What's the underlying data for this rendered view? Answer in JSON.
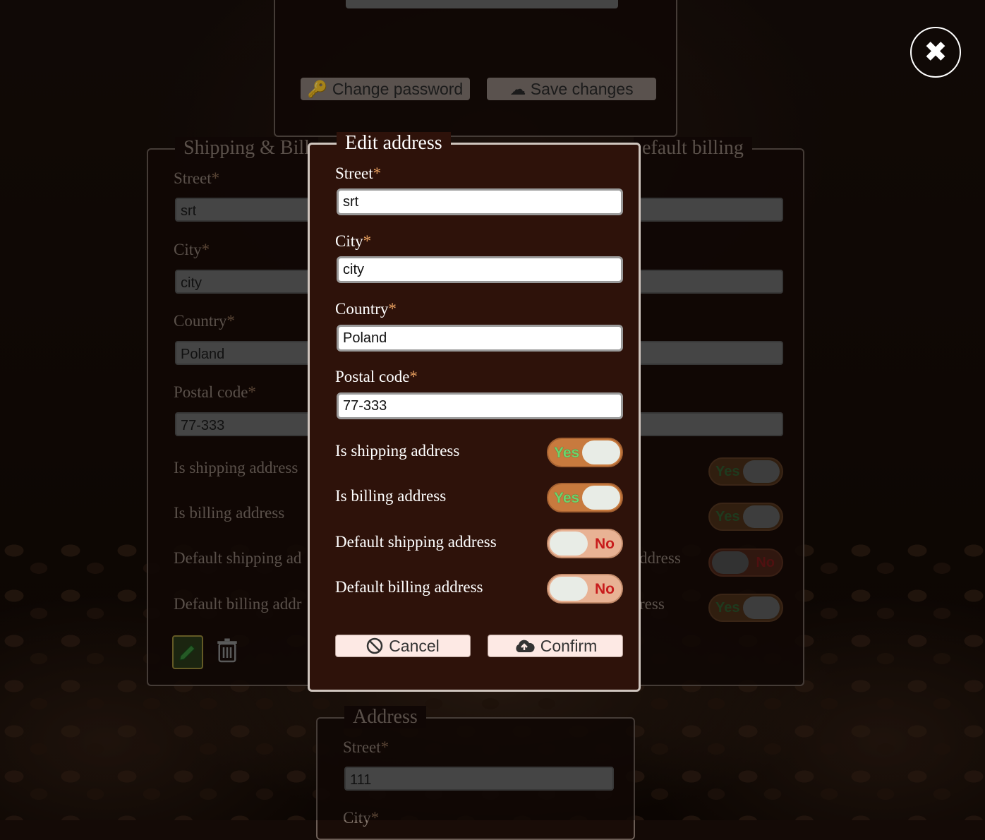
{
  "close_label": "✖",
  "top_panel": {
    "change_password": "Change password",
    "save_changes": "Save changes"
  },
  "address_card_1": {
    "legend": "Shipping & Billing - Default shipping & Default billing",
    "legend_left": "Shipping & Bill",
    "legend_right": "efault billing",
    "street_label": "Street",
    "street_value": "srt",
    "city_label": "City",
    "city_value": "city",
    "country_label": "Country",
    "country_value": "Poland",
    "postal_label": "Postal code",
    "postal_value": "77-333",
    "is_shipping_label": "Is shipping address",
    "is_billing_label": "Is billing address",
    "default_shipping_label": "Default shipping ad",
    "default_billing_label": "Default billing addr",
    "right_default_shipping_frag": "ddress",
    "right_default_billing_frag": "ress",
    "toggles": [
      "Yes",
      "Yes",
      "No",
      "Yes"
    ]
  },
  "address_card_2": {
    "legend": "Address",
    "street_label": "Street",
    "street_value": "111",
    "city_label": "City"
  },
  "modal": {
    "title": "Edit address",
    "required_mark": "*",
    "street_label": "Street",
    "street_value": "srt",
    "city_label": "City",
    "city_value": "city",
    "country_label": "Country",
    "country_value": "Poland",
    "postal_label": "Postal code",
    "postal_value": "77-333",
    "is_shipping_label": "Is shipping address",
    "is_shipping_value": "Yes",
    "is_billing_label": "Is billing address",
    "is_billing_value": "Yes",
    "default_shipping_label": "Default shipping address",
    "default_shipping_value": "No",
    "default_billing_label": "Default billing address",
    "default_billing_value": "No",
    "cancel": "Cancel",
    "confirm": "Confirm"
  },
  "colors": {
    "modal_bg": "#2e120a",
    "toggle_yes": "#c87a3e",
    "toggle_no": "#e8b294",
    "button_bg": "#fde9e4",
    "required": "#e8a060"
  }
}
